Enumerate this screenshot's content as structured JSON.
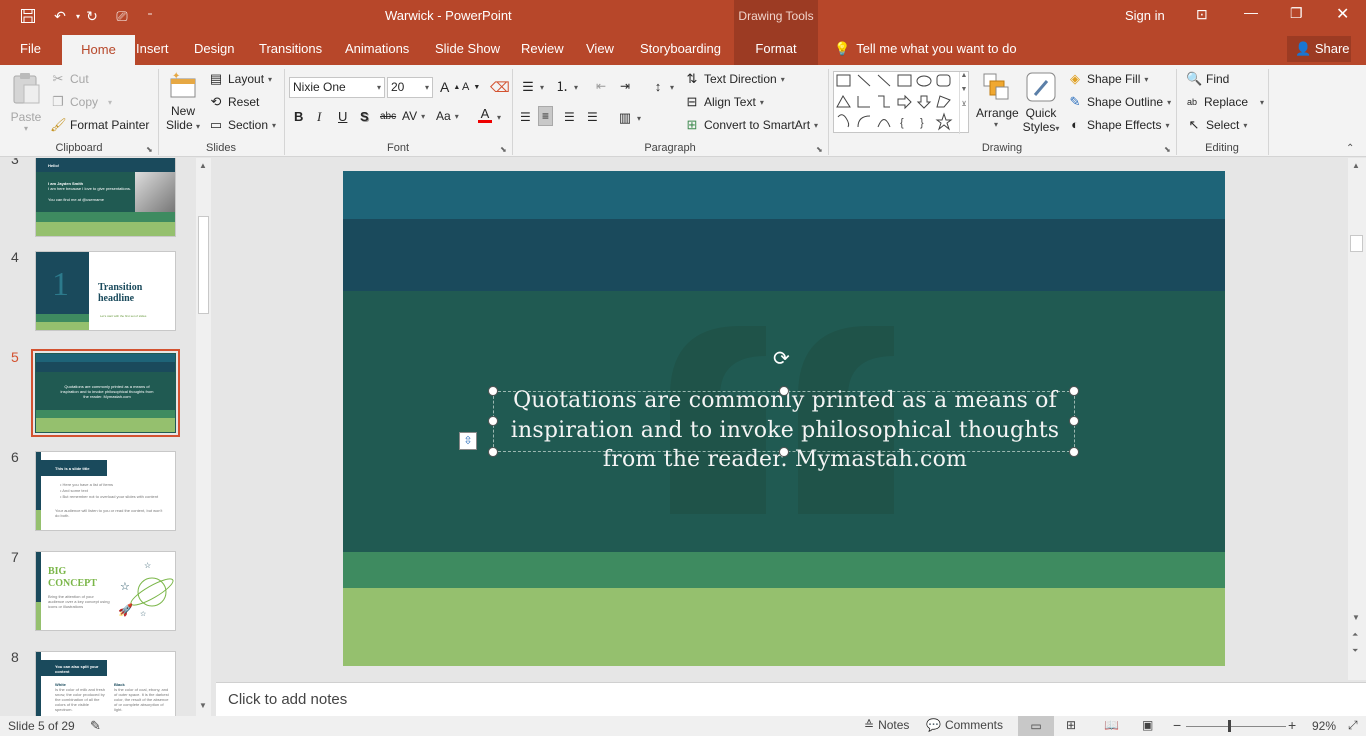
{
  "app": {
    "title": "Warwick  -  PowerPoint",
    "context_tools": "Drawing Tools",
    "signin": "Sign in"
  },
  "tabs": [
    "File",
    "Home",
    "Insert",
    "Design",
    "Transitions",
    "Animations",
    "Slide Show",
    "Review",
    "View",
    "Storyboarding",
    "Format"
  ],
  "tell_me": "Tell me what you want to do",
  "share": "Share",
  "clipboard": {
    "paste": "Paste",
    "cut": "Cut",
    "copy": "Copy",
    "format_painter": "Format Painter",
    "label": "Clipboard"
  },
  "slides_group": {
    "new_slide_1": "New",
    "new_slide_2": "Slide",
    "layout": "Layout",
    "reset": "Reset",
    "section": "Section",
    "label": "Slides"
  },
  "font": {
    "name": "Nixie One",
    "size": "20",
    "label": "Font"
  },
  "paragraph": {
    "text_direction": "Text Direction",
    "align_text": "Align Text",
    "convert": "Convert to SmartArt",
    "label": "Paragraph"
  },
  "drawing": {
    "arrange": "Arrange",
    "quick_1": "Quick",
    "quick_2": "Styles",
    "shape_fill": "Shape Fill",
    "shape_outline": "Shape Outline",
    "shape_effects": "Shape Effects",
    "label": "Drawing"
  },
  "editing": {
    "find": "Find",
    "replace": "Replace",
    "select": "Select",
    "label": "Editing"
  },
  "thumbs": [
    {
      "num": "3",
      "title": "Hello!",
      "line1": "I am Jayden Smith",
      "line2": "I am here because I love to give presentations.",
      "line3": "You can find me at @username"
    },
    {
      "num": "4",
      "big": "1",
      "title": "Transition headline",
      "sub": "Let's start with the first set of slides"
    },
    {
      "num": "5",
      "text": "Quotations are commonly printed as a means of inspiration and to invoke philosophical thoughts from the reader. Mymastah.com"
    },
    {
      "num": "6",
      "title": "This is a slide title",
      "b1": "Here you have a list of items",
      "b2": "And some text",
      "b3": "But remember not to overload your slides with content",
      "p": "Your audience will listen to you or read the content, but won't do both."
    },
    {
      "num": "7",
      "big1": "BIG",
      "big2": "CONCEPT",
      "p": "Bring the attention of your audience over a key concept using icons or illustrations"
    },
    {
      "num": "8",
      "title": "You can also split your content",
      "c1t": "White",
      "c1": "Is the color of milk and fresh snow, the color produced by the combination of all the colors of the visible spectrum.",
      "c2t": "Black",
      "c2": "Is the color of coal, ebony, and of outer space. It is the darkest color, the result of the absence of or complete absorption of light."
    }
  ],
  "slide": {
    "quote": "Quotations are commonly printed as a means of inspiration and to invoke philosophical thoughts from the reader. Mymastah.com"
  },
  "notes": {
    "placeholder": "Click to add notes"
  },
  "status": {
    "slide_info": "Slide 5 of 29",
    "notes": "Notes",
    "comments": "Comments",
    "zoom": "92%"
  },
  "colors": {
    "accent": "#b7472a",
    "band1": "#1e6478",
    "band2": "#1a4a5c",
    "band3": "#205a52",
    "band4": "#3e8b60",
    "band5": "#95c06e"
  }
}
